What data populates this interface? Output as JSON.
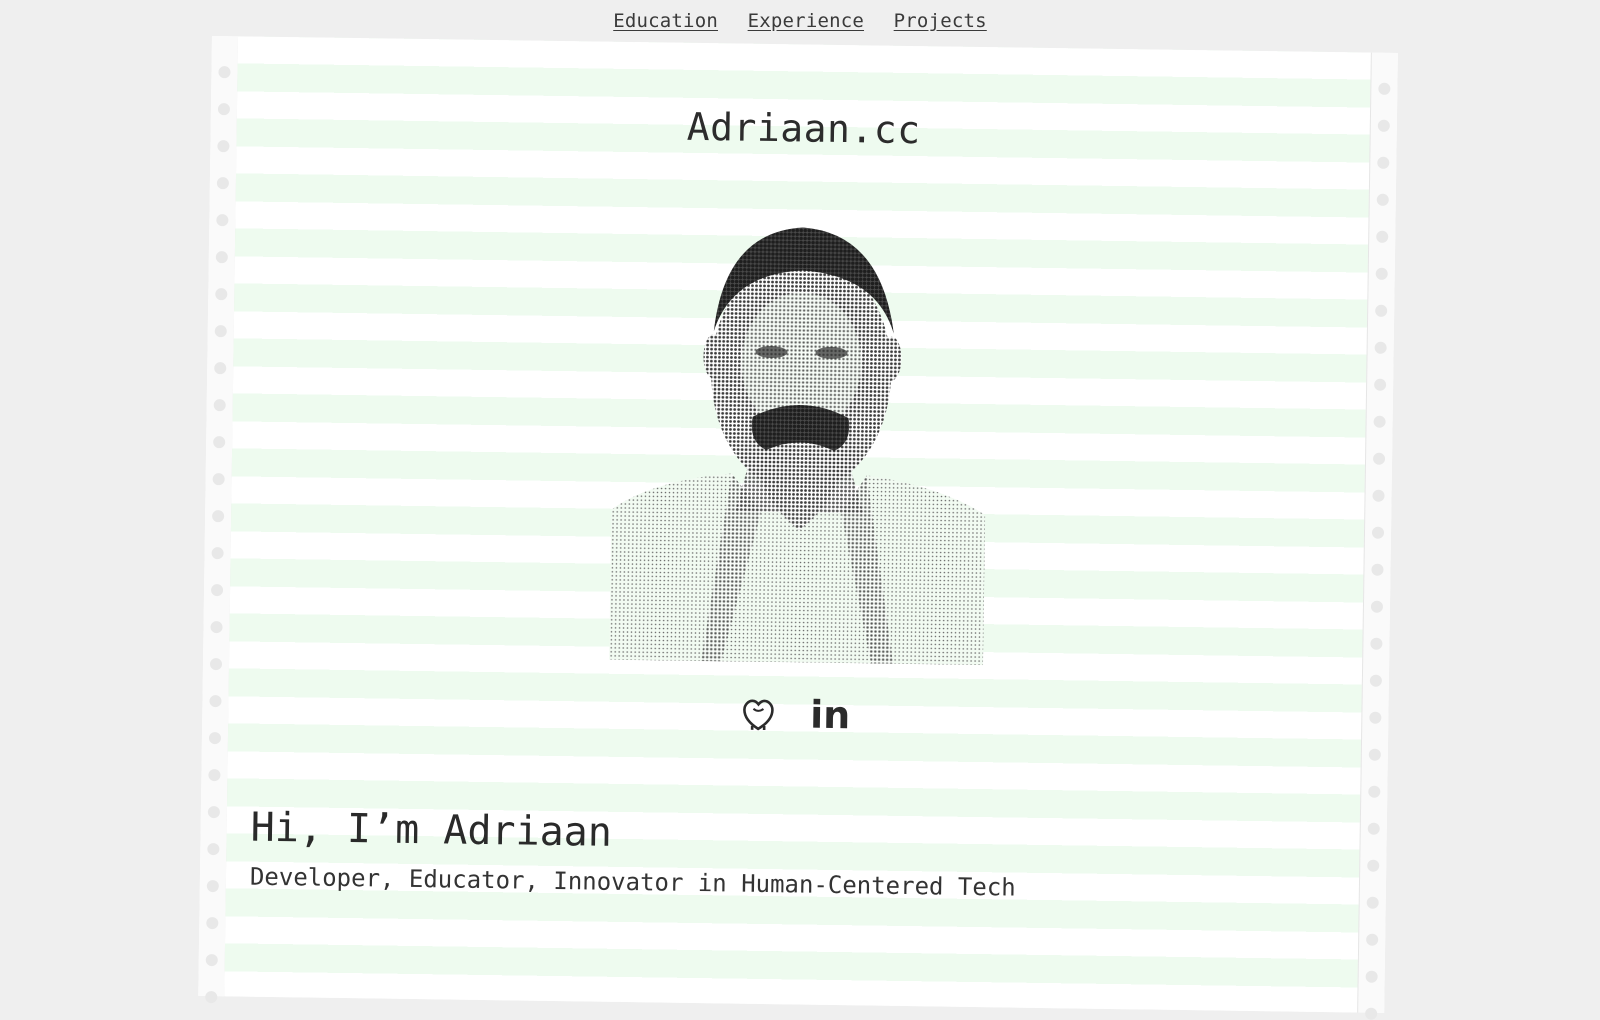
{
  "nav": {
    "items": [
      {
        "label": "Education"
      },
      {
        "label": "Experience"
      },
      {
        "label": "Projects"
      }
    ]
  },
  "site": {
    "title": "Adriaan.cc"
  },
  "portrait": {
    "alt": "Halftone portrait of Adriaan"
  },
  "socials": {
    "github_icon": "github-icon",
    "linkedin_label": "in"
  },
  "intro": {
    "greeting": "Hi, I’m Adriaan",
    "tagline": "Developer, Educator, Innovator in Human-Centered Tech"
  },
  "colors": {
    "background": "#efefef",
    "paper": "#ffffff",
    "stripe": "#eefbef",
    "text": "#2a2a2a"
  }
}
